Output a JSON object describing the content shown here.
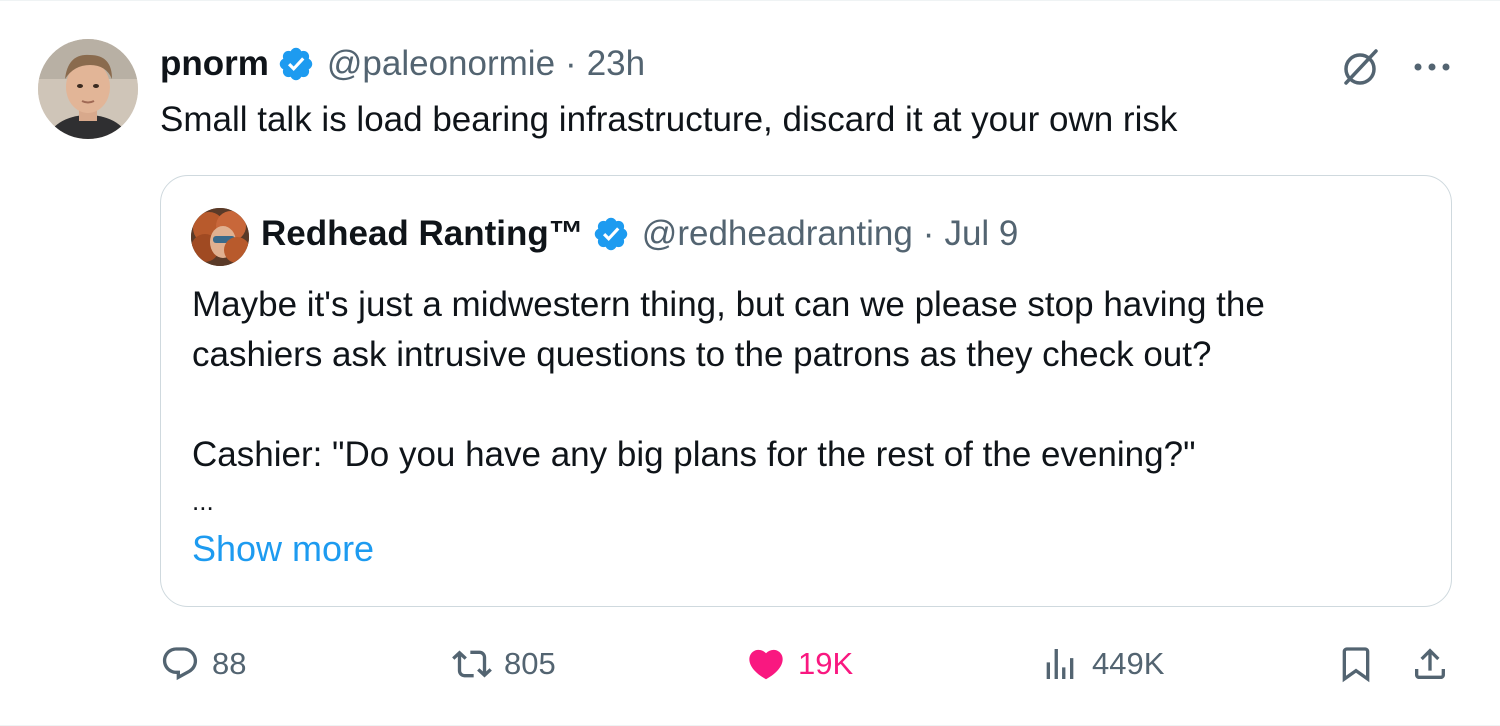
{
  "tweet": {
    "author_name": "pnorm",
    "author_handle": "@paleonormie",
    "separator": "·",
    "time": "23h",
    "text": "Small talk is load bearing infrastructure, discard it at your own risk"
  },
  "quote": {
    "author_name": "Redhead Ranting™",
    "author_handle": "@redheadranting",
    "separator": "·",
    "date": "Jul 9",
    "lines": [
      "Maybe it's just a midwestern thing, but can we please stop having the",
      "cashiers ask intrusive questions to the patrons as they check out?",
      "Cashier: \"Do you have any big plans for the rest of the evening?\""
    ],
    "ellipsis": "...",
    "show_more": "Show more"
  },
  "actions": {
    "replies": "88",
    "reposts": "805",
    "likes": "19K",
    "views": "449K"
  },
  "colors": {
    "verified": "#1d9bf0",
    "link": "#1d9bf0",
    "like": "#f91880",
    "muted": "#536471",
    "border": "#cfd9de"
  },
  "icons": {
    "top_right": [
      "grok-slash-icon",
      "more-icon"
    ],
    "actions": [
      "reply-icon",
      "repost-icon",
      "heart-icon",
      "views-icon",
      "bookmark-icon",
      "share-icon"
    ]
  }
}
